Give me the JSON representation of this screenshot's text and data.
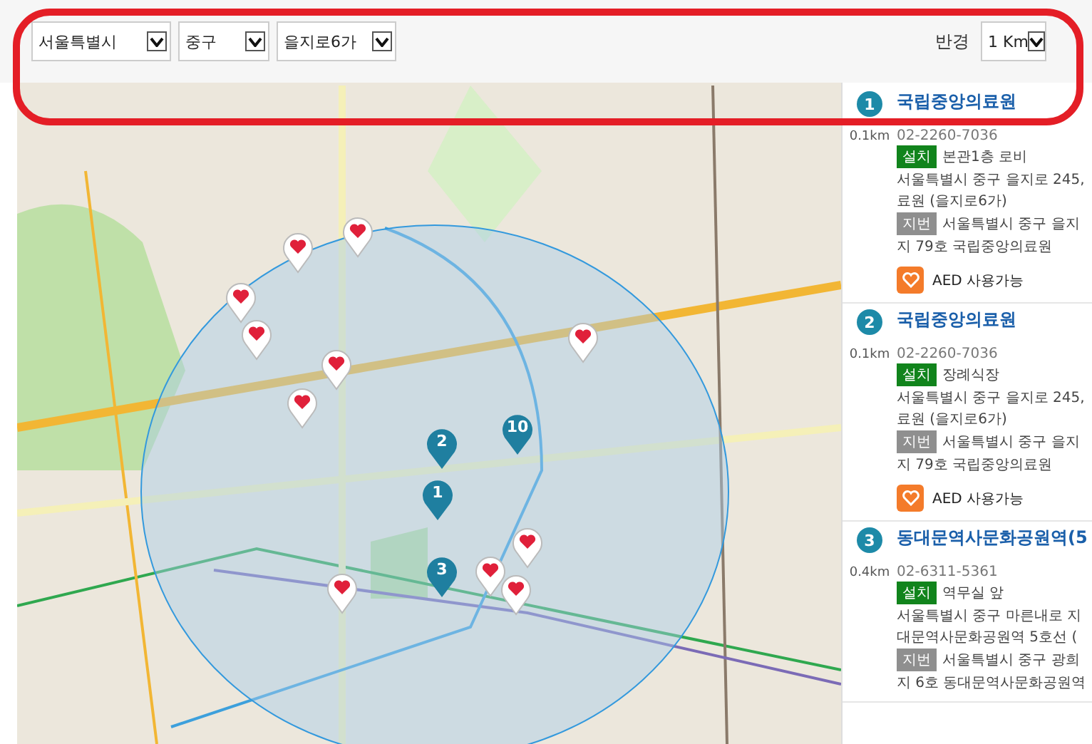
{
  "filters": [
    {
      "value": "서울특별시"
    },
    {
      "value": "중구"
    },
    {
      "value": "을지로6가"
    }
  ],
  "radius": {
    "label": "반경",
    "value": "1 Km"
  },
  "map": {
    "markers": [
      {
        "kind": "heart"
      },
      {
        "kind": "heart"
      },
      {
        "kind": "heart"
      },
      {
        "kind": "heart"
      },
      {
        "kind": "heart"
      },
      {
        "kind": "heart"
      },
      {
        "kind": "heart"
      },
      {
        "kind": "heart"
      },
      {
        "kind": "heart"
      },
      {
        "kind": "heart"
      },
      {
        "kind": "heart"
      },
      {
        "kind": "number",
        "label": "10"
      },
      {
        "kind": "number",
        "label": "2"
      },
      {
        "kind": "number",
        "label": "1"
      },
      {
        "kind": "number",
        "label": "3"
      }
    ]
  },
  "results": [
    {
      "number": "1",
      "distance": "0.1km",
      "name": "국립중앙의료원",
      "phone": "02-2260-7036",
      "install_tag": "설치",
      "install_place": "본관1층 로비",
      "address_lines": [
        "서울특별시 중구 을지로 245,",
        "료원 (을지로6가)"
      ],
      "lot_tag": "지번",
      "lot_lines": [
        "서울특별시 중구 을지",
        "지 79호 국립중앙의료원"
      ],
      "status": "AED 사용가능"
    },
    {
      "number": "2",
      "distance": "0.1km",
      "name": "국립중앙의료원",
      "phone": "02-2260-7036",
      "install_tag": "설치",
      "install_place": "장례식장",
      "address_lines": [
        "서울특별시 중구 을지로 245,",
        "료원 (을지로6가)"
      ],
      "lot_tag": "지번",
      "lot_lines": [
        "서울특별시 중구 을지",
        "지 79호 국립중앙의료원"
      ],
      "status": "AED 사용가능"
    },
    {
      "number": "3",
      "distance": "0.4km",
      "name": "동대문역사문화공원역(5",
      "phone": "02-6311-5361",
      "install_tag": "설치",
      "install_place": "역무실 앞",
      "address_lines": [
        "서울특별시 중구 마른내로 지",
        "대문역사문화공원역 5호선 ("
      ],
      "lot_tag": "지번",
      "lot_lines": [
        "서울특별시 중구 광희",
        "지 6호 동대문역사문화공원역"
      ]
    }
  ]
}
